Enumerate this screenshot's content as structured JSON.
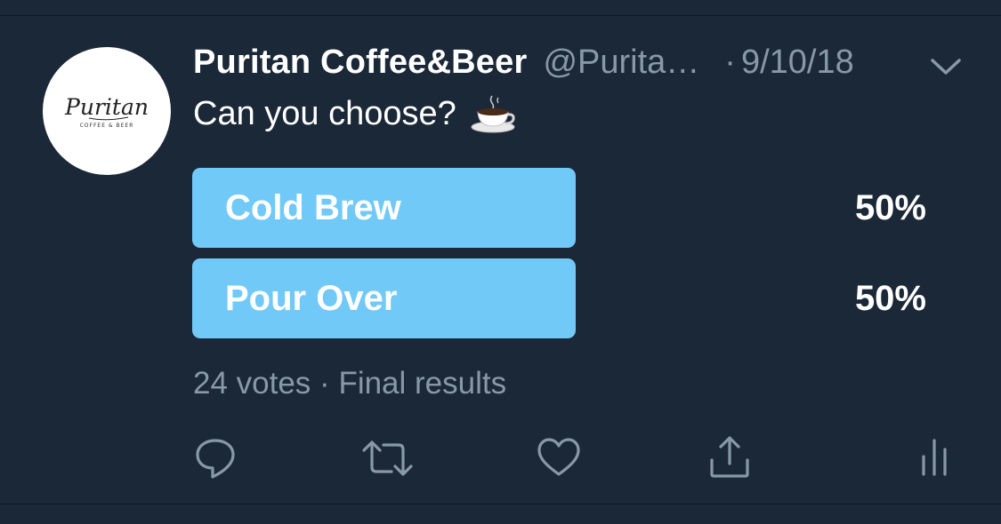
{
  "tweet": {
    "display_name": "Puritan Coffee&Beer",
    "handle": "@Purita…",
    "separator": "·",
    "timestamp": "9/10/18",
    "text": "Can you choose?",
    "text_emoji": "coffee-cup-emoji"
  },
  "avatar": {
    "logo_text": "Puritan",
    "logo_subtext": "COFFEE & BEER"
  },
  "poll": {
    "options": [
      {
        "label": "Cold Brew",
        "percent_text": "50%",
        "fraction": 0.5
      },
      {
        "label": "Pour Over",
        "percent_text": "50%",
        "fraction": 0.5
      }
    ],
    "votes_text": "24 votes",
    "meta_separator": "·",
    "status_text": "Final results"
  },
  "actions": {
    "icons": [
      "reply-icon",
      "retweet-icon",
      "like-icon",
      "share-icon",
      "analytics-icon"
    ]
  },
  "colors": {
    "background": "#1b2838",
    "poll_bar": "#71c9f8",
    "secondary_text": "#8899a6",
    "primary_text": "#ffffff"
  }
}
